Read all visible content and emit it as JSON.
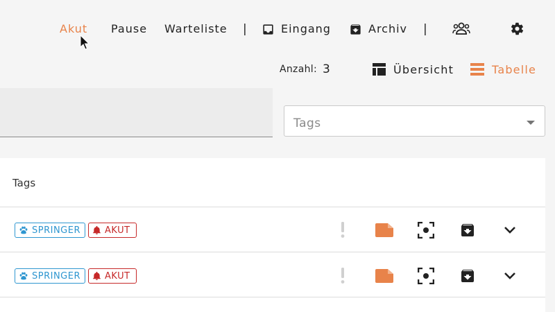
{
  "nav": {
    "akut": "Akut",
    "pause": "Pause",
    "warteliste": "Warteliste",
    "separator": "|",
    "eingang": "Eingang",
    "archiv": "Archiv",
    "active_color": "#e8834a"
  },
  "toolbar": {
    "count_label": "Anzahl:",
    "count_value": "3",
    "overview_label": "Übersicht",
    "table_label": "Tabelle"
  },
  "filters": {
    "tags_placeholder": "Tags"
  },
  "table": {
    "header_tags": "Tags",
    "rows": [
      {
        "tags": [
          "SPRINGER",
          "AKUT"
        ]
      },
      {
        "tags": [
          "SPRINGER",
          "AKUT"
        ]
      }
    ]
  },
  "colors": {
    "springer": "#2e96d0",
    "akut": "#c62828",
    "accent": "#e8834a"
  }
}
